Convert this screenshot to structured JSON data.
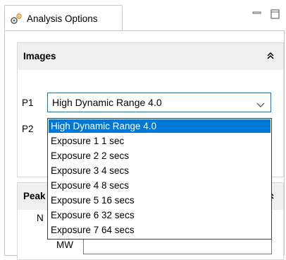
{
  "tab": {
    "title": "Analysis Options",
    "icon": "gears-icon"
  },
  "window_buttons": {
    "minimize": "minimize-icon",
    "maximize": "maximize-icon"
  },
  "images_section": {
    "title": "Images",
    "collapse_icon": "chevron-double-up-icon",
    "p1_label": "P1",
    "p2_label": "P2",
    "p1_selected": "High Dynamic Range 4.0",
    "options": [
      "High Dynamic Range 4.0",
      "Exposure 1  1 sec",
      "Exposure 2  2 secs",
      "Exposure 3  4 secs",
      "Exposure 4  8 secs",
      "Exposure 5  16 secs",
      "Exposure 6  32 secs",
      "Exposure 7  64 secs"
    ],
    "highlighted_index": 0
  },
  "peak_section": {
    "title": "Peak",
    "n_label": "N",
    "mw_label": "MW"
  },
  "colors": {
    "accent": "#0078d7",
    "header_bg": "#f0f0f0"
  }
}
